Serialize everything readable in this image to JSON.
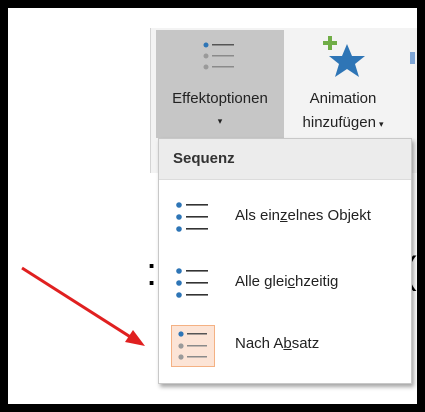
{
  "ribbon": {
    "effect_options": {
      "label": "Effektoptionen",
      "chevron": "▾",
      "icon": "list-bullets-icon"
    },
    "add_animation": {
      "label_line1": "Animation",
      "label_line2": "hinzufügen",
      "chevron": "▾",
      "icon": "star-plus-icon"
    }
  },
  "dropdown": {
    "header": "Sequenz",
    "items": [
      {
        "pre": "Als ein",
        "under": "z",
        "post": "elnes Objekt",
        "selected": false
      },
      {
        "pre": "Alle glei",
        "under": "c",
        "post": "hzeitig",
        "selected": false
      },
      {
        "pre": "Nach A",
        "under": "b",
        "post": "satz",
        "selected": true
      }
    ]
  },
  "colors": {
    "accent_blue": "#2e75b6",
    "star_blue": "#2e75b6",
    "plus_green": "#70ad47",
    "selection_fill": "#fce4d6",
    "selection_border": "#f4b183",
    "arrow_red": "#e02020"
  }
}
